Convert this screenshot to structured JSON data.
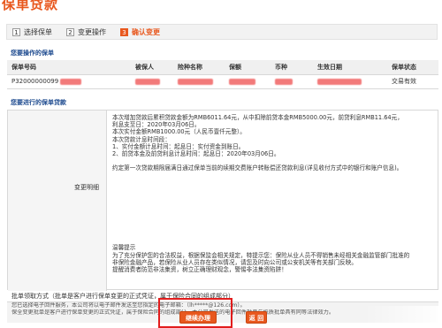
{
  "page": {
    "title": "保单贷款"
  },
  "steps": [
    {
      "num": "1",
      "label": "选择保单"
    },
    {
      "num": "2",
      "label": "变更操作"
    },
    {
      "num": "3",
      "label": "确认变更"
    }
  ],
  "policy_section": {
    "title": "您要操作的保单",
    "headers": [
      "保单号码",
      "被保人",
      "险种名称",
      "保额",
      "币种",
      "生效日期",
      "保单状态"
    ],
    "row": {
      "policy_no": "P32000000099",
      "status": "交易有效"
    }
  },
  "loan_section": {
    "title": "您要进行的保单贷款",
    "label": "变更明细",
    "lines": [
      "本次增加贷款后累积贷款金额为RMB6011.64元，从中扣除前贷本金RMB5000.00元，前贷利息RMB11.64元，",
      "利息支至日：2020年03月06日。",
      "本次实付金额RMB1000.00元（人民币壹仟元整）。",
      "本次贷款计息时间段：",
      "1、实付金额计息时间：起息日：实付资金到账日。",
      "2、前贷本金及前贷利息计息时间：起息日：2020年03月06日。"
    ],
    "repay_note": "约定第一次贷款期限届满日通过保单当前的续期交费账户转账偿还贷款利息(详见收付方式中的银行和账户信息)。",
    "warning_title": "温馨提示",
    "warning_lines": [
      "为了充分保护您的合法权益，根据保监会相关规定，特提示您：保险从业人员不得销售未经相关金融监管部门批准的",
      "非保险金融产品，若保险从业人员存在类似情况，请您及时向公司或公安机关等有关部门反映。",
      "提醒消费者防范非法集资，树立正确理财观念，警惕非法集资陷阱！"
    ]
  },
  "ack_section": {
    "title": "批单领取方式（批单是客户进行保单变更的正式凭证，属于保险合同的组成部分）",
    "line1": "您已选择电子回件服务，本公司将以电子邮件发送至您指定的电子邮箱：（lh*****@126.com）。",
    "line2": "保全变更批单是客户进行保单变更的正式凭证，属于保险合同的组成部分。本公司发送的电子回件批单与纸质批单具有同等法律效力。"
  },
  "buttons": {
    "continue": "继续办理",
    "back": "返 回"
  },
  "colors": {
    "accent": "#e8581e",
    "highlight": "#e21d1d",
    "section_title": "#1d4a8f"
  }
}
